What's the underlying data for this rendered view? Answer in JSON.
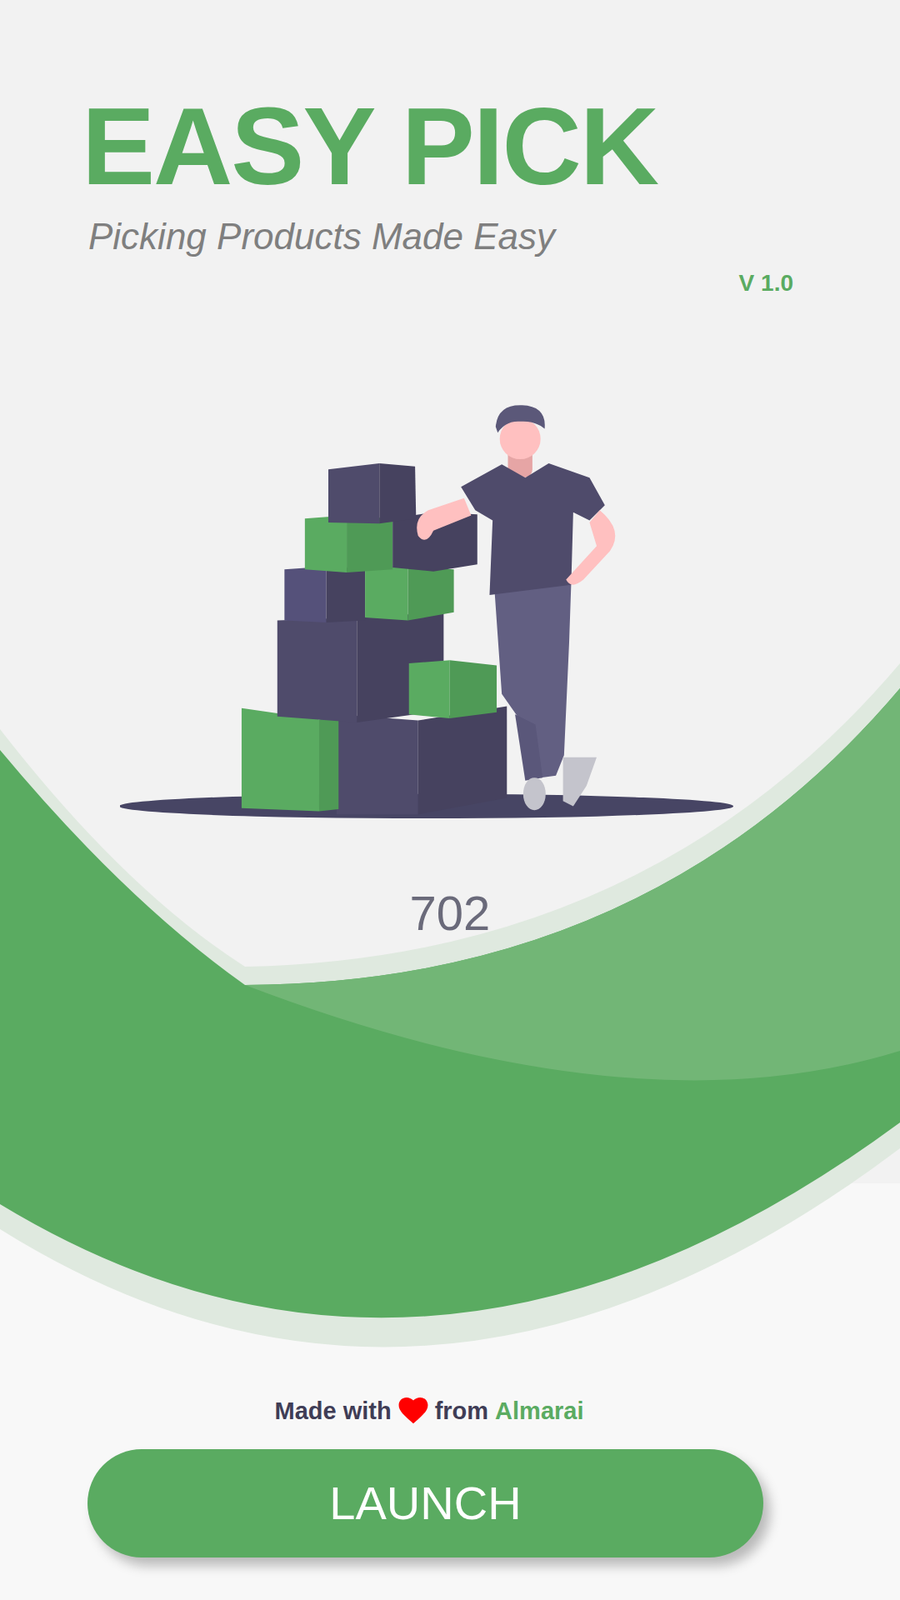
{
  "app": {
    "title": "EASY PICK",
    "subtitle": "Picking Products Made Easy",
    "version": "V 1.0"
  },
  "count": "702",
  "footer": {
    "prefix": "Made with",
    "middle": "from",
    "brand": "Almarai"
  },
  "button": {
    "label": "LAUNCH"
  }
}
